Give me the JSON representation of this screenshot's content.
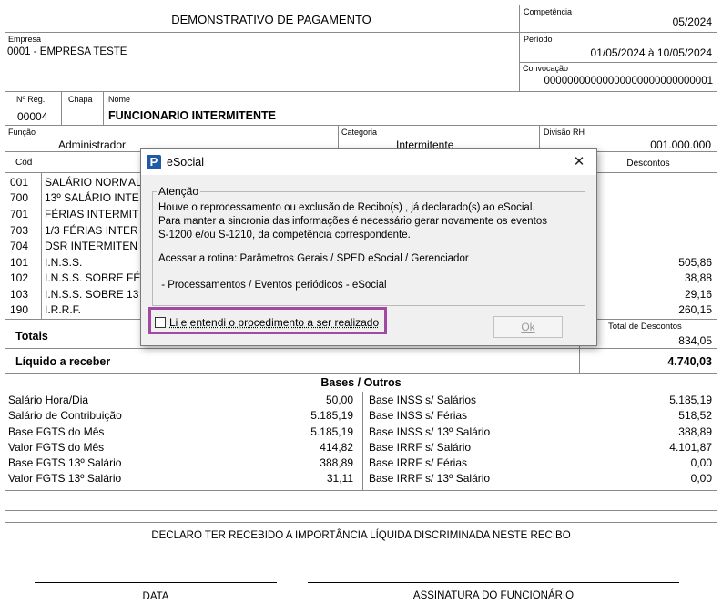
{
  "header": {
    "title": "DEMONSTRATIVO DE PAGAMENTO",
    "competencia_label": "Competência",
    "competencia_value": "05/2024",
    "empresa_label": "Empresa",
    "empresa_value": "0001 - EMPRESA TESTE",
    "periodo_label": "Período",
    "periodo_value": "01/05/2024 à 10/05/2024",
    "convocacao_label": "Convocação",
    "convocacao_value": "00000000000000000000000000001"
  },
  "employee": {
    "nreg_label": "Nº Reg.",
    "nreg_value": "00004",
    "chapa_label": "Chapa",
    "chapa_value": "",
    "nome_label": "Nome",
    "nome_value": "FUNCIONARIO INTERMITENTE",
    "funcao_label": "Função",
    "funcao_value": "Administrador",
    "categoria_label": "Categoria",
    "categoria_value": "Intermitente",
    "divisao_label": "Divisão RH",
    "divisao_value": "001.000.000"
  },
  "table": {
    "cod_header": "Cód",
    "descontos_header": "Descontos",
    "rows": [
      {
        "cod": "001",
        "desc": "SALÁRIO NORMAL",
        "desconto": ""
      },
      {
        "cod": "700",
        "desc": "13º SALÁRIO INTE",
        "desconto": ""
      },
      {
        "cod": "701",
        "desc": "FÉRIAS INTERMIT",
        "desconto": ""
      },
      {
        "cod": "703",
        "desc": "1/3 FÉRIAS INTER",
        "desconto": ""
      },
      {
        "cod": "704",
        "desc": "DSR INTERMITEN",
        "desconto": ""
      },
      {
        "cod": "101",
        "desc": "I.N.S.S.",
        "desconto": "505,86"
      },
      {
        "cod": "102",
        "desc": "I.N.S.S. SOBRE FÉ",
        "desconto": "38,88"
      },
      {
        "cod": "103",
        "desc": "I.N.S.S. SOBRE 13",
        "desconto": "29,16"
      },
      {
        "cod": "190",
        "desc": "I.R.R.F.",
        "desconto": "260,15"
      }
    ],
    "totais_label": "Totais",
    "total_descontos_label": "Total de Descontos",
    "total_descontos_value": "834,05",
    "liquido_label": "Líquido a receber",
    "liquido_value": "4.740,03"
  },
  "bases": {
    "title": "Bases / Outros",
    "left": [
      {
        "label": "Salário Hora/Dia",
        "value": "50,00"
      },
      {
        "label": "Salário de Contribuição",
        "value": "5.185,19"
      },
      {
        "label": "Base FGTS do Mês",
        "value": "5.185,19"
      },
      {
        "label": "Valor FGTS do Mês",
        "value": "414,82"
      },
      {
        "label": "Base FGTS 13º Salário",
        "value": "388,89"
      },
      {
        "label": "Valor FGTS 13º Salário",
        "value": "31,11"
      }
    ],
    "right": [
      {
        "label": "Base INSS s/ Salários",
        "value": "5.185,19"
      },
      {
        "label": "Base INSS s/ Férias",
        "value": "518,52"
      },
      {
        "label": "Base INSS s/ 13º Salário",
        "value": "388,89"
      },
      {
        "label": "Base IRRF s/ Salário",
        "value": "4.101,87"
      },
      {
        "label": "Base IRRF s/ Férias",
        "value": "0,00"
      },
      {
        "label": "Base IRRF s/ 13º Salário",
        "value": "0,00"
      }
    ]
  },
  "footer": {
    "declaro": "DECLARO TER RECEBIDO A IMPORTÂNCIA LÍQUIDA DISCRIMINADA NESTE RECIBO",
    "data_label": "DATA",
    "assinatura_label": "ASSINATURA DO FUNCIONÁRIO"
  },
  "dialog": {
    "title": "eSocial",
    "app_icon": "P",
    "close_symbol": "✕",
    "group_title": "Atenção",
    "msg_line1": "Houve o reprocessamento ou exclusão  de Recibo(s) , já  declarado(s) ao eSocial.",
    "msg_line2": "Para manter a sincronia das informações é necessário gerar novamente os eventos",
    "msg_line3": "S-1200 e/ou S-1210, da competência correspondente.",
    "msg_line4": "Acessar a rotina: Parâmetros Gerais / SPED eSocial / Gerenciador",
    "msg_line5": " - Processamentos / Eventos periódicos - eSocial",
    "checkbox_label": "Li e entendi o procedimento a ser realizado",
    "checkbox_checked": false,
    "ok_label": "Ok",
    "highlight_color": "#a349a4",
    "icon_color": "#1e5aa8"
  }
}
